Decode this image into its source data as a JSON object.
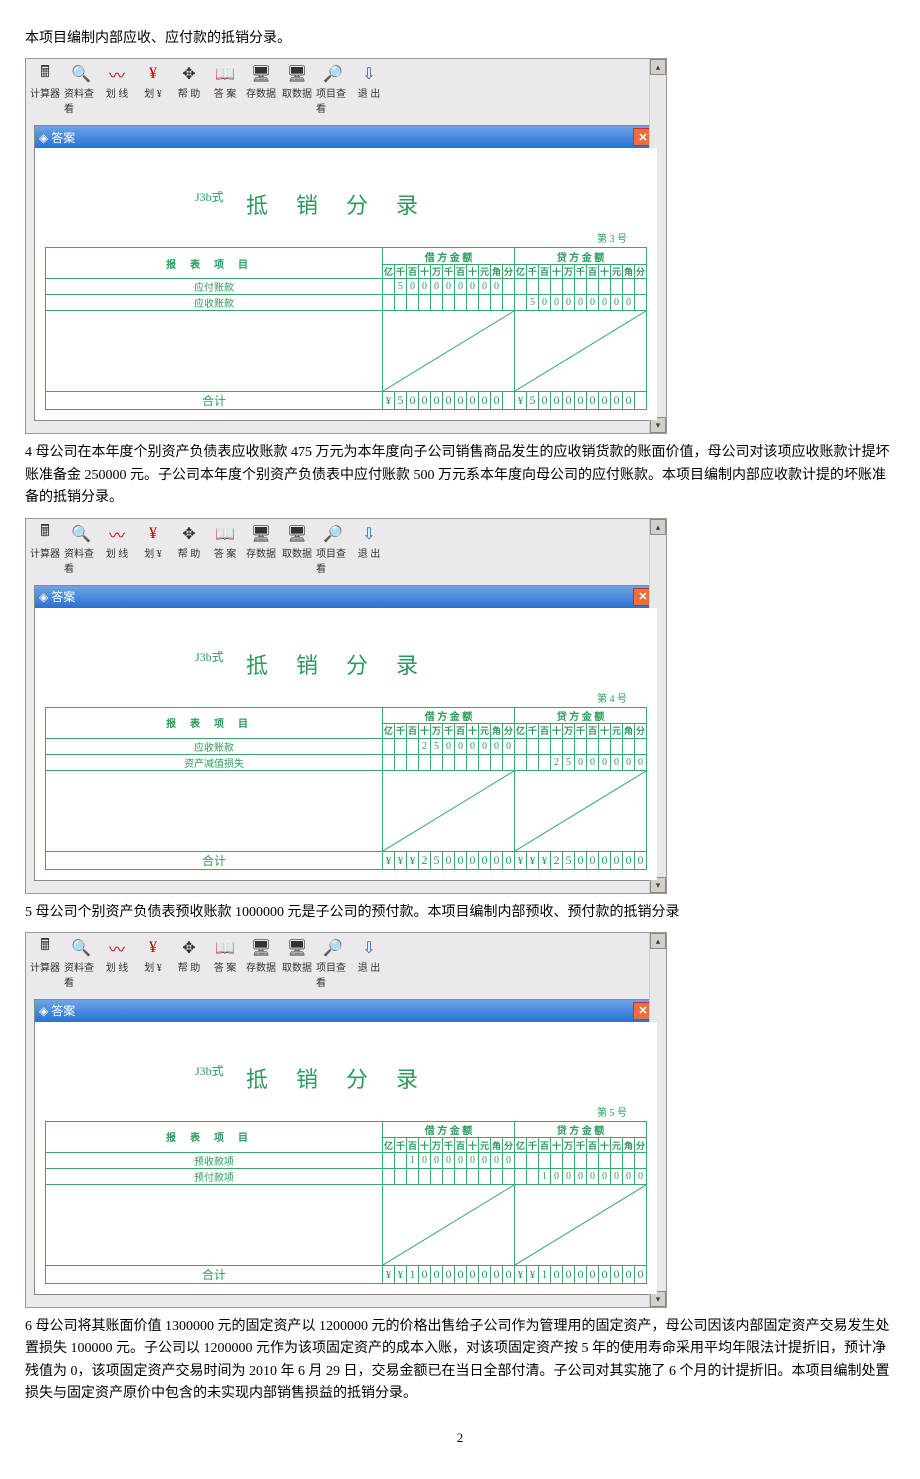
{
  "intro_text": "本项目编制内部应收、应付款的抵销分录。",
  "toolbar": {
    "items": [
      {
        "icon": "🖩",
        "label": "计算器"
      },
      {
        "icon": "🔍",
        "label": "资料查看"
      },
      {
        "icon": "〰",
        "label": "划 线"
      },
      {
        "icon": "¥",
        "label": "划 ¥"
      },
      {
        "icon": "✥",
        "label": "帮 助"
      },
      {
        "icon": "📖",
        "label": "答 案"
      },
      {
        "icon": "🖥",
        "label": "存数据"
      },
      {
        "icon": "🖥",
        "label": "取数据"
      },
      {
        "icon": "🔎",
        "label": "项目查看"
      },
      {
        "icon": "⇩",
        "label": "退 出"
      }
    ]
  },
  "window_title": "答案",
  "form_type": "J3b式",
  "entry_title": "抵销分录",
  "col_headers": {
    "item": "报表项目",
    "debit": "借 方 金 额",
    "credit": "贷 方 金 额",
    "digits": [
      "亿",
      "千",
      "百",
      "十",
      "万",
      "千",
      "百",
      "十",
      "元",
      "角",
      "分"
    ]
  },
  "total_label": "合计",
  "yen": "¥",
  "entries": [
    {
      "page_no": "第 3 号",
      "rows": [
        {
          "name": "应付账款",
          "debit": [
            "",
            "5",
            "0",
            "0",
            "0",
            "0",
            "0",
            "0",
            "0",
            "0"
          ],
          "credit": []
        },
        {
          "name": "应收账款",
          "debit": [],
          "credit": [
            "",
            "5",
            "0",
            "0",
            "0",
            "0",
            "0",
            "0",
            "0",
            "0"
          ]
        }
      ],
      "total_debit": [
        "",
        "5",
        "0",
        "0",
        "0",
        "0",
        "0",
        "0",
        "0",
        "0"
      ],
      "total_credit": [
        "",
        "5",
        "0",
        "0",
        "0",
        "0",
        "0",
        "0",
        "0",
        "0"
      ]
    },
    {
      "page_no": "第 4 号",
      "rows": [
        {
          "name": "应收账款",
          "debit": [
            "",
            "",
            "",
            "2",
            "5",
            "0",
            "0",
            "0",
            "0",
            "0",
            "0"
          ],
          "credit": []
        },
        {
          "name": "资产减值损失",
          "debit": [],
          "credit": [
            "",
            "",
            "",
            "2",
            "5",
            "0",
            "0",
            "0",
            "0",
            "0",
            "0"
          ]
        }
      ],
      "total_debit": [
        "",
        "",
        "",
        "2",
        "5",
        "0",
        "0",
        "0",
        "0",
        "0",
        "0"
      ],
      "total_credit": [
        "",
        "",
        "",
        "2",
        "5",
        "0",
        "0",
        "0",
        "0",
        "0",
        "0"
      ]
    },
    {
      "page_no": "第 5 号",
      "rows": [
        {
          "name": "预收款项",
          "debit": [
            "",
            "",
            "1",
            "0",
            "0",
            "0",
            "0",
            "0",
            "0",
            "0",
            "0"
          ],
          "credit": []
        },
        {
          "name": "预付款项",
          "debit": [],
          "credit": [
            "",
            "",
            "1",
            "0",
            "0",
            "0",
            "0",
            "0",
            "0",
            "0",
            "0"
          ]
        }
      ],
      "total_debit": [
        "",
        "",
        "1",
        "0",
        "0",
        "0",
        "0",
        "0",
        "0",
        "0",
        "0"
      ],
      "total_credit": [
        "",
        "",
        "1",
        "0",
        "0",
        "0",
        "0",
        "0",
        "0",
        "0",
        "0"
      ]
    }
  ],
  "para4": "4 母公司在本年度个别资产负债表应收账款 475 万元为本年度向子公司销售商品发生的应收销货款的账面价值，母公司对该项应收账款计提坏账准备金 250000 元。子公司本年度个别资产负债表中应付账款 500 万元系本年度向母公司的应付账款。本项目编制内部应收款计提的坏账准备的抵销分录。",
  "para5": "5 母公司个别资产负债表预收账款 1000000 元是子公司的预付款。本项目编制内部预收、预付款的抵销分录",
  "para6": "6 母公司将其账面价值 1300000 元的固定资产以 1200000 元的价格出售给子公司作为管理用的固定资产，母公司因该内部固定资产交易发生处置损失 100000 元。子公司以 1200000 元作为该项固定资产的成本入账，对该项固定资产按 5 年的使用寿命采用平均年限法计提折旧，预计净残值为 0，该项固定资产交易时间为 2010 年 6 月 29 日，交易金额已在当日全部付清。子公司对其实施了 6 个月的计提折旧。本项目编制处置损失与固定资产原价中包含的未实现内部销售损益的抵销分录。",
  "page_number": "2"
}
